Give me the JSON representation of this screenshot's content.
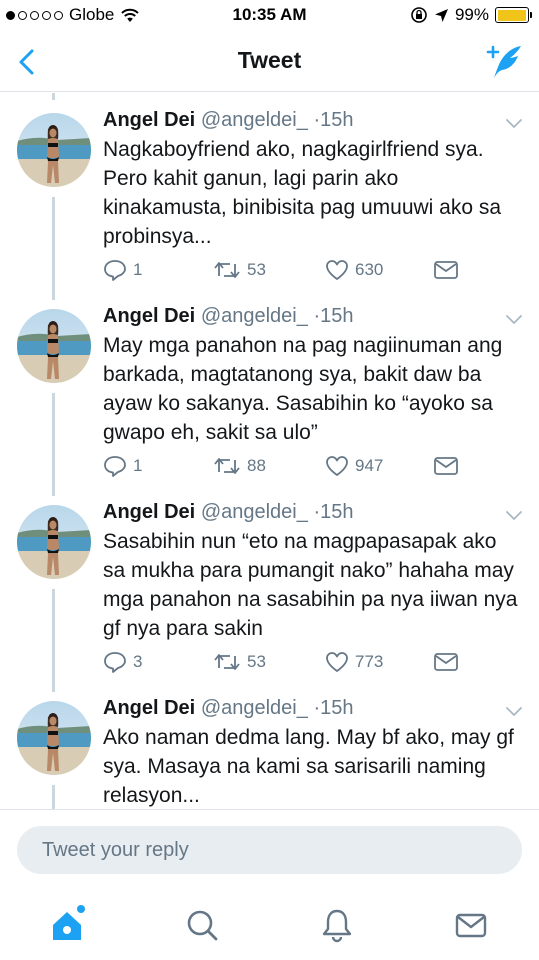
{
  "status_bar": {
    "carrier": "Globe",
    "time": "10:35 AM",
    "battery_percent": "99%",
    "signal_bars": 1,
    "signal_total": 5,
    "battery_level": 0.99,
    "battery_color": "#f0c419"
  },
  "nav": {
    "title": "Tweet",
    "back_icon": "chevron-left-icon",
    "compose_icon": "compose-tweet-icon",
    "accent_color": "#1da1f2"
  },
  "tweets": [
    {
      "name": "Angel Dei",
      "handle": "@angeldei_",
      "separator": "·",
      "time": "15h",
      "text": "Nagkaboyfriend ako, nagkagirlfriend sya. Pero kahit ganun, lagi parin ako kinakamusta, binibisita pag umuuwi ako sa probinsya...",
      "replies": "1",
      "retweets": "53",
      "likes": "630"
    },
    {
      "name": "Angel Dei",
      "handle": "@angeldei_",
      "separator": "·",
      "time": "15h",
      "text": "May mga panahon na pag nagiinuman ang barkada, magtatanong sya, bakit daw ba ayaw ko sakanya. Sasabihin ko “ayoko sa gwapo eh, sakit sa ulo”",
      "replies": "1",
      "retweets": "88",
      "likes": "947"
    },
    {
      "name": "Angel Dei",
      "handle": "@angeldei_",
      "separator": "·",
      "time": "15h",
      "text": "Sasabihin nun “eto na magpapasapak ako sa mukha para pumangit nako” hahaha may mga panahon na sasabihin pa nya iiwan nya gf nya para sakin",
      "replies": "3",
      "retweets": "53",
      "likes": "773"
    },
    {
      "name": "Angel Dei",
      "handle": "@angeldei_",
      "separator": "·",
      "time": "15h",
      "text": "Ako naman dedma lang. May bf ako, may gf sya. Masaya na kami sa sarisarili naming relasyon...",
      "replies": "",
      "retweets": "",
      "likes": ""
    }
  ],
  "reply": {
    "placeholder": "Tweet your reply"
  },
  "tabs": [
    {
      "name": "home-icon",
      "active": true
    },
    {
      "name": "search-icon",
      "active": false
    },
    {
      "name": "notifications-bell-icon",
      "active": false
    },
    {
      "name": "messages-envelope-icon",
      "active": false
    }
  ],
  "colors": {
    "text": "#14171a",
    "secondary": "#657786",
    "divider": "#dfe3e7",
    "thread_line": "#ccd6dd",
    "reply_bg": "#e8edf1"
  }
}
